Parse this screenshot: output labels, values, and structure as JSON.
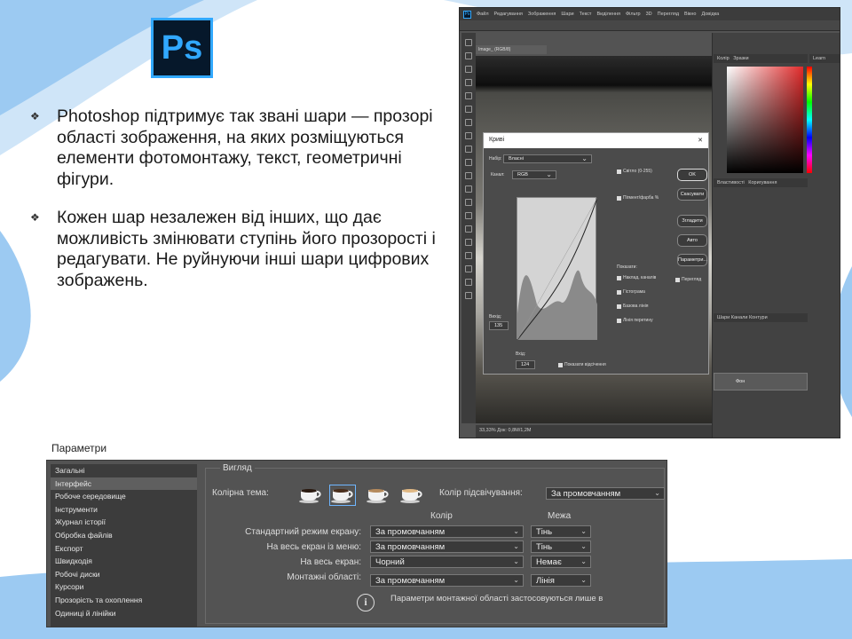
{
  "logo": {
    "text": "Ps"
  },
  "bullets": [
    {
      "text": "Photoshop підтримує так звані шари — прозорі області зображення, на яких розміщуються елементи фотомонтажу, текст, геометричні фігури."
    },
    {
      "text": "Кожен шар незалежен від інших, що дає можливість змінювати ступінь його прозорості і редагувати. Не руйнуючи інші шари цифрових зображень."
    }
  ],
  "photoshop": {
    "menu": [
      "Файл",
      "Редагування",
      "Зображення",
      "Шари",
      "Текст",
      "Виділення",
      "Фільтр",
      "3D",
      "Перегляд",
      "Вікно",
      "Довідка"
    ],
    "doc_tab": "Image_ (RGB/8)",
    "status": "33,33%   Док: 0,8M/1,2M",
    "curves": {
      "title": "Криві",
      "preset_label": "Набір:",
      "preset_value": "Власні",
      "channel_label": "Канал:",
      "channel_value": "RGB",
      "buttons": [
        "OK",
        "Скасувати",
        "Згладити",
        "Авто",
        "Параметри..."
      ],
      "output_label": "Вихід:",
      "output_value": "135",
      "input_label": "Вхід:",
      "input_value": "124",
      "clipping_label": "Показати відсічення",
      "preview_label": "Перегляд",
      "display_options": [
        "Світло (0-255)",
        "Пігмент/фарба %"
      ],
      "show_label": "Показати:",
      "show_options": [
        "Наклад. каналів",
        "Гістограма",
        "Базова лінія",
        "Лінія перетину"
      ]
    },
    "panels": {
      "color_tab": "Колір",
      "swatches_tab": "Зразки",
      "learn": "Learn",
      "properties_tab": "Властивості",
      "adjustments_tab": "Коригування",
      "layers_tab": "Шари",
      "channels_tab": "Канали",
      "paths_tab": "Контури",
      "layer_name": "Фон"
    }
  },
  "preferences": {
    "window_title": "Параметри",
    "sidebar": [
      {
        "label": "Загальні",
        "active": false
      },
      {
        "label": "Інтерфейс",
        "active": true
      },
      {
        "label": "Робоче середовище",
        "active": false
      },
      {
        "label": "Інструменти",
        "active": false
      },
      {
        "label": "Журнал історії",
        "active": false
      },
      {
        "label": "Обробка файлів",
        "active": false
      },
      {
        "label": "Експорт",
        "active": false
      },
      {
        "label": "Швидкодія",
        "active": false
      },
      {
        "label": "Робочі диски",
        "active": false
      },
      {
        "label": "Курсори",
        "active": false
      },
      {
        "label": "Прозорість та охоплення",
        "active": false
      },
      {
        "label": "Одиниці й лінійки",
        "active": false
      }
    ],
    "group_title": "Вигляд",
    "color_theme_label": "Колірна тема:",
    "highlight_label": "Колір підсвічування:",
    "highlight_value": "За промовчанням",
    "column_color": "Колір",
    "column_border": "Межа",
    "rows": [
      {
        "label": "Стандартний режим екрану:",
        "color": "За промовчанням",
        "border": "Тінь"
      },
      {
        "label": "На весь екран із меню:",
        "color": "За промовчанням",
        "border": "Тінь"
      },
      {
        "label": "На весь екран:",
        "color": "Чорний",
        "border": "Немає"
      },
      {
        "label": "Монтажні області:",
        "color": "За промовчанням",
        "border": "Лінія"
      }
    ],
    "info_text": "Параметри монтажної області застосовуються лише в"
  },
  "colors": {
    "wave": "#9ccaf2",
    "ps_blue": "#31a8ff",
    "ps_dark": "#06182b"
  }
}
